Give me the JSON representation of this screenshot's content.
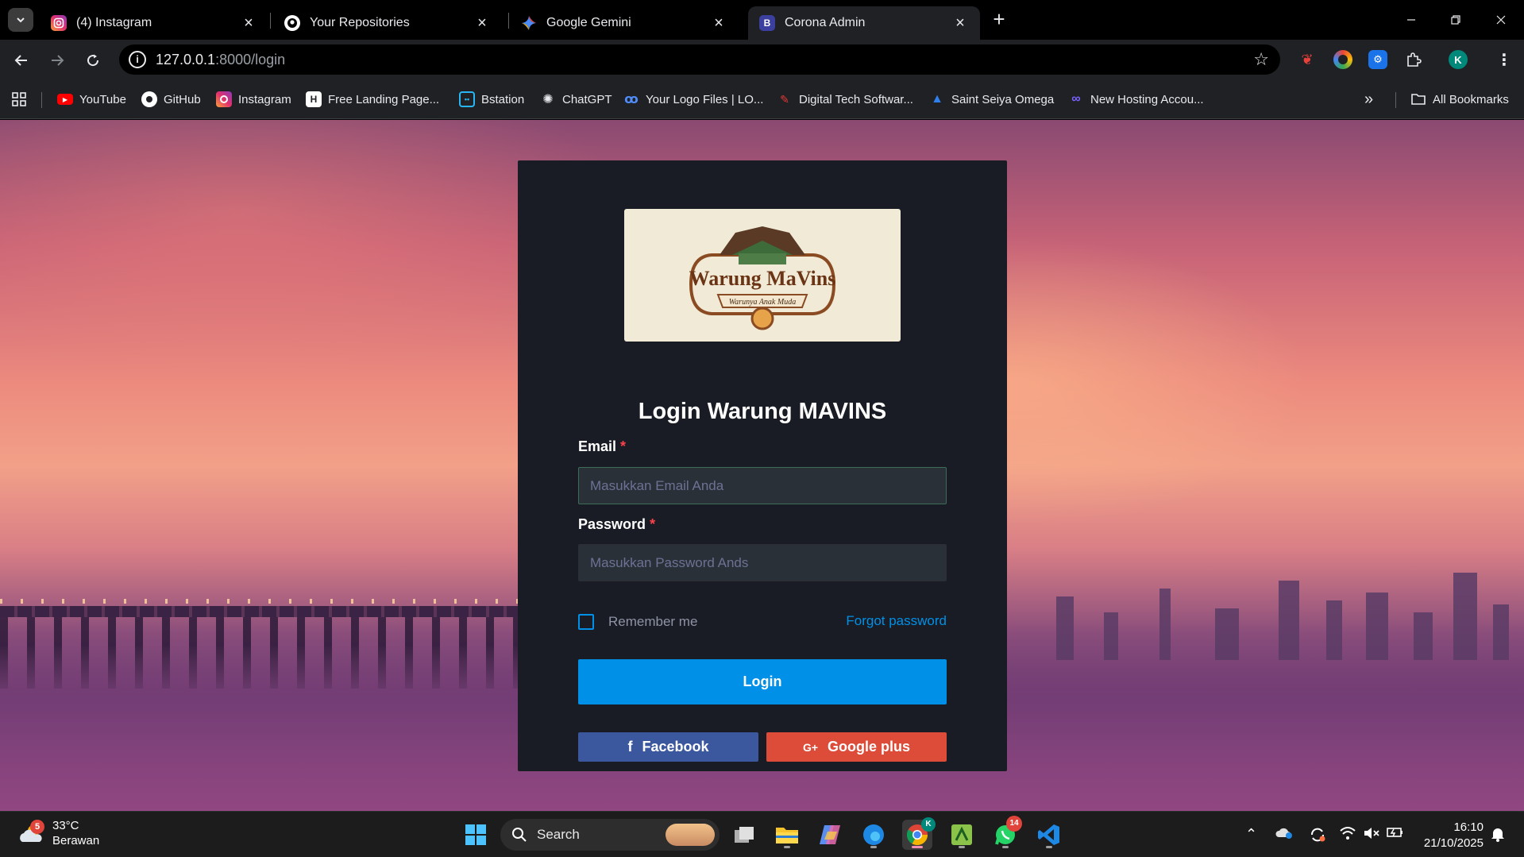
{
  "browser": {
    "tabs": [
      {
        "title": "(4) Instagram",
        "active": false,
        "icon": "instagram-icon"
      },
      {
        "title": "Your Repositories",
        "active": false,
        "icon": "github-icon"
      },
      {
        "title": "Google Gemini",
        "active": false,
        "icon": "gemini-icon"
      },
      {
        "title": "Corona Admin",
        "active": true,
        "icon": "bootstrap-icon"
      }
    ],
    "url_host": "127.0.0.1",
    "url_path": ":8000/login",
    "profile_initial": "K",
    "bookmarks": [
      {
        "label": "YouTube",
        "icon": "youtube-icon"
      },
      {
        "label": "GitHub",
        "icon": "github-icon"
      },
      {
        "label": "Instagram",
        "icon": "instagram-icon"
      },
      {
        "label": "Free Landing Page...",
        "icon": "h-icon"
      },
      {
        "label": "Bstation",
        "icon": "tv-icon"
      },
      {
        "label": "ChatGPT",
        "icon": "openai-icon"
      },
      {
        "label": "Your Logo Files | LO...",
        "icon": "logo-icon"
      },
      {
        "label": "Digital Tech Softwar...",
        "icon": "digital-icon"
      },
      {
        "label": "Saint Seiya Omega",
        "icon": "seiya-icon"
      },
      {
        "label": "New Hosting Accou...",
        "icon": "hosting-icon"
      }
    ],
    "all_bookmarks": "All Bookmarks"
  },
  "login": {
    "title": "Login Warung MAVINS",
    "logo": {
      "brand": "Warung MaVins",
      "tagline": "Warunya Anak Muda"
    },
    "email_label": "Email",
    "email_placeholder": "Masukkan Email Anda",
    "password_label": "Password",
    "password_placeholder": "Masukkan Password Ands",
    "required_mark": "*",
    "remember_label": "Remember me",
    "forgot_label": "Forgot password",
    "login_button": "Login",
    "facebook_button": "Facebook",
    "google_button": "Google plus"
  },
  "taskbar": {
    "temperature": "33°C",
    "weather": "Berawan",
    "weather_badge": "5",
    "search": "Search",
    "whatsapp_badge": "14",
    "chrome_badge": "K",
    "time": "16:10",
    "date": "21/10/2025"
  },
  "colors": {
    "accent": "#0090e7",
    "card": "#191c24",
    "input": "#2a3038",
    "facebook": "#3b579d",
    "google": "#dd4b39",
    "required": "#fc424a"
  }
}
